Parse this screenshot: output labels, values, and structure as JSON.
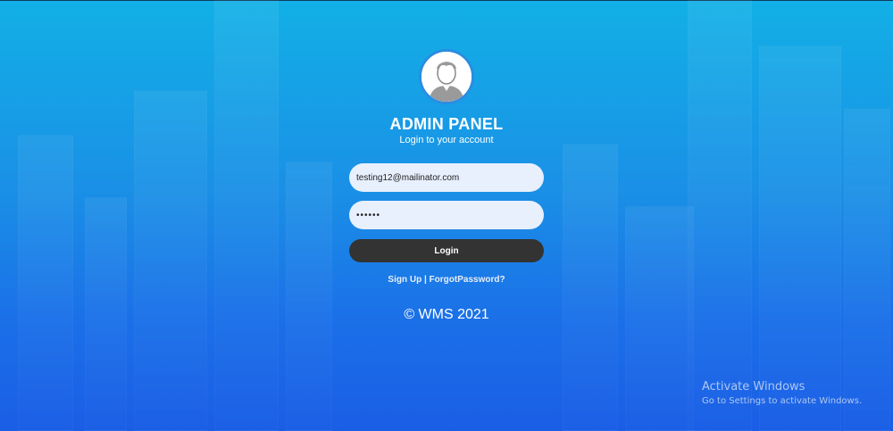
{
  "header": {
    "title": "ADMIN PANEL",
    "subtitle": "Login to your account"
  },
  "avatar": {
    "icon": "user-avatar-icon"
  },
  "form": {
    "email_value": "testing12@mailinator.com",
    "password_value": "••••••",
    "login_label": "Login"
  },
  "links": {
    "signup_label": "Sign Up",
    "separator": " | ",
    "forgot_label": "ForgotPassword?"
  },
  "footer": {
    "copyright": "© WMS 2021"
  },
  "watermark": {
    "line1": "Activate Windows",
    "line2": "Go to Settings to activate Windows."
  },
  "colors": {
    "background_top": "#12b0e6",
    "background_bottom": "#1a5ee6",
    "input_bg": "#e8f0fe",
    "button_bg": "#333333",
    "avatar_border": "#2a8de0"
  }
}
